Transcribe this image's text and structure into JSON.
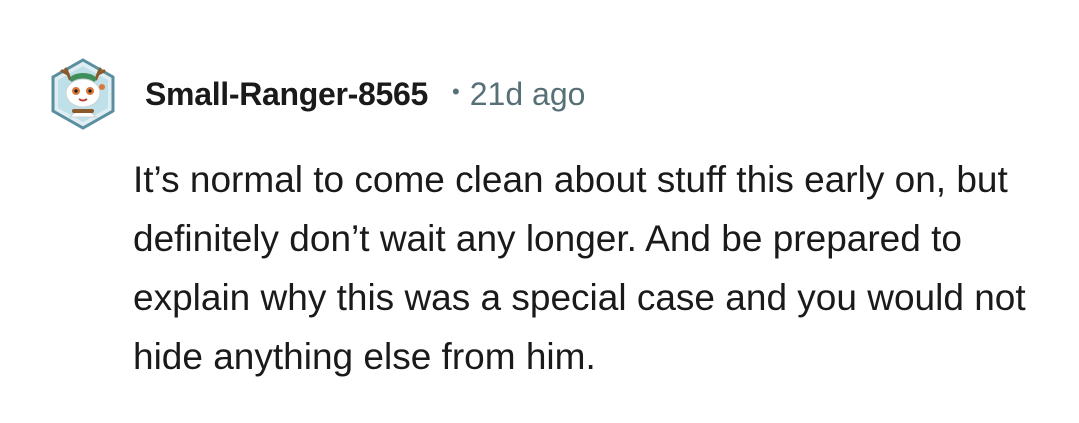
{
  "comment": {
    "avatar_icon": "snoo-avatar-icon",
    "username": "Small-Ranger-8565",
    "separator": "•",
    "timestamp": "21d ago",
    "body": "It’s normal to come clean about stuff this early on, but definitely don’t wait any longer. And be prepared to explain why this was a special case and you would not hide anything else from him."
  },
  "colors": {
    "text": "#1a1a1b",
    "meta": "#576f76",
    "avatar_bg": "#5a8fa0",
    "avatar_accent": "#d9783a"
  }
}
